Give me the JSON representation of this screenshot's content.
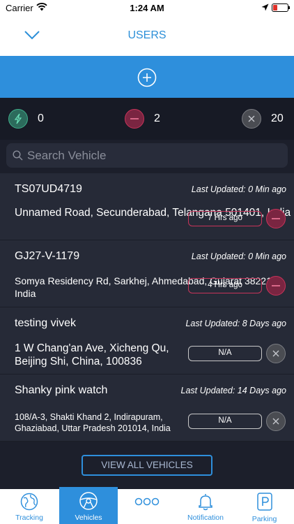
{
  "status_bar": {
    "carrier": "Carrier",
    "time": "1:24 AM"
  },
  "nav": {
    "title": "USERS"
  },
  "counts": {
    "moving": "0",
    "stopped": "2",
    "offline": "20"
  },
  "search": {
    "placeholder": "Search Vehicle"
  },
  "vehicles": [
    {
      "name": "TS07UD4719",
      "updated": "Last Updated: 0 Min ago",
      "address": "Unnamed Road, Secunderabad, Telangana 501401, India",
      "status_text": "7 Hrs ago",
      "status": "stopped"
    },
    {
      "name": "GJ27-V-1179",
      "updated": "Last Updated: 0 Min ago",
      "address": "Somya Residency Rd, Sarkhej, Ahmedabad, Gujarat 382210, India",
      "status_text": "4 Hrs ago",
      "status": "stopped"
    },
    {
      "name": "testing vivek",
      "updated": "Last Updated: 8 Days ago",
      "address": "1 W Chang'an Ave, Xicheng Qu, Beijing Shi, China, 100836",
      "status_text": "N/A",
      "status": "offline"
    },
    {
      "name": "Shanky pink watch",
      "updated": "Last Updated: 14 Days ago",
      "address": "108/A-3, Shakti Khand 2, Indirapuram, Ghaziabad, Uttar Pradesh 201014, India",
      "status_text": "N/A",
      "status": "offline"
    }
  ],
  "view_all_label": "VIEW ALL VEHICLES",
  "tabs": [
    {
      "label": "Tracking",
      "icon": "globe-icon"
    },
    {
      "label": "Vehicles",
      "icon": "steering-wheel-icon",
      "active": true
    },
    {
      "label": "",
      "icon": "more-icon"
    },
    {
      "label": "Notification",
      "icon": "bell-icon"
    },
    {
      "label": "Parking",
      "icon": "parking-icon"
    }
  ],
  "colors": {
    "accent": "#2e8fdc",
    "moving": "#3fae8a",
    "stopped": "#c8345a",
    "offline": "#8a8a8a",
    "background": "#1c1f2b"
  }
}
